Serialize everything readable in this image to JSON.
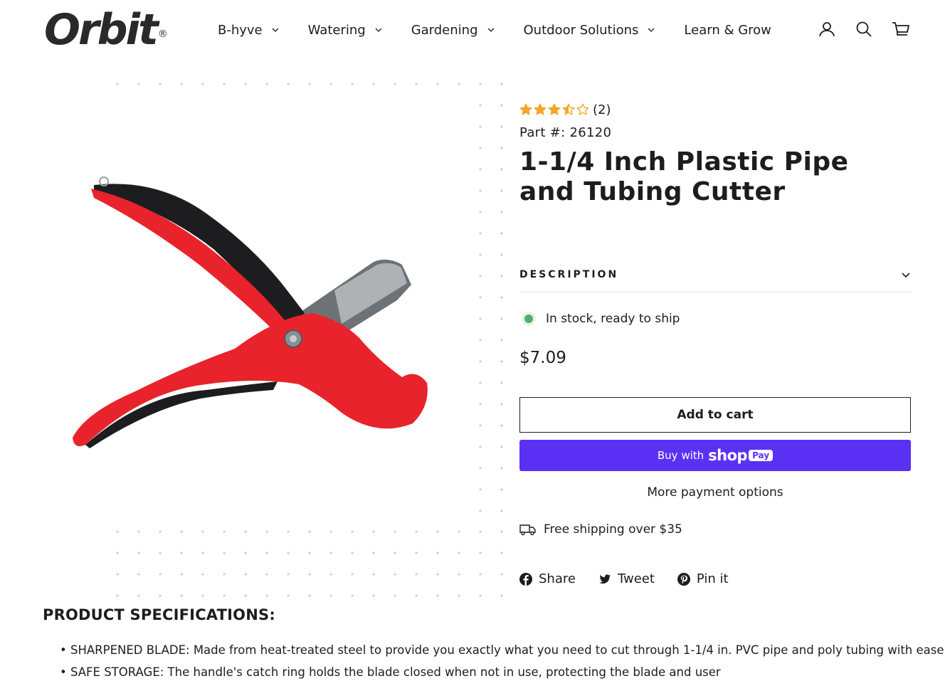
{
  "brand": {
    "logo_text": "Orbit",
    "logo_mark": "®"
  },
  "nav": {
    "items": [
      {
        "label": "B-hyve"
      },
      {
        "label": "Watering"
      },
      {
        "label": "Gardening"
      },
      {
        "label": "Outdoor Solutions"
      },
      {
        "label": "Learn & Grow"
      }
    ]
  },
  "header_icons": [
    "account-icon",
    "search-icon",
    "cart-icon"
  ],
  "product": {
    "rating_value": 3.5,
    "rating_max": 5,
    "rating_count": "(2)",
    "part_number": "Part #: 26120",
    "title": "1-1/4 Inch Plastic Pipe and Tubing Cutter",
    "description_label": "DESCRIPTION",
    "stock_text": "In stock, ready to ship",
    "price": "$7.09",
    "add_to_cart_label": "Add to cart",
    "shoppay_prefix": "Buy with",
    "shoppay_shop": "shop",
    "shoppay_pay": "Pay",
    "more_payment_label": "More payment options",
    "shipping_text": "Free shipping over $35"
  },
  "social": {
    "share": "Share",
    "tweet": "Tweet",
    "pin": "Pin it"
  },
  "specs": {
    "title": "PRODUCT SPECIFICATIONS:",
    "items": [
      "SHARPENED BLADE: Made from heat-treated steel to provide you exactly what you need to cut through 1-1/4 in. PVC pipe and poly tubing with ease",
      "SAFE STORAGE: The handle's catch ring holds the blade closed when not in use, protecting the blade and user"
    ]
  },
  "colors": {
    "star": "#f5a623",
    "stock_dot": "#56ad6a",
    "shoppay": "#5a31f4",
    "tool_red": "#e8232b"
  }
}
